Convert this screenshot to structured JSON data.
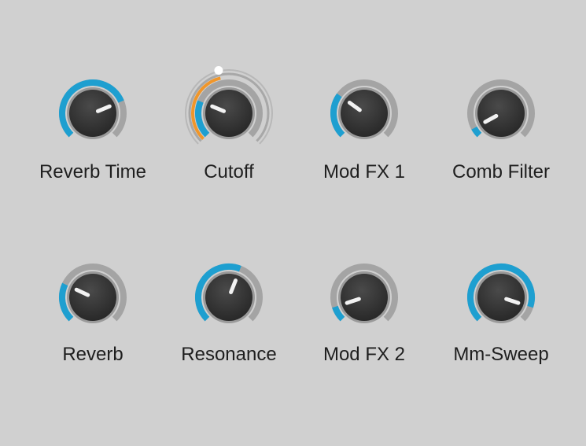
{
  "panel": {
    "accent_color": "#1e9fd0",
    "secondary_accent_color": "#f0962a",
    "knobs": [
      {
        "label": "Reverb Time",
        "value": 0.75,
        "icon": "rotary-knob-icon"
      },
      {
        "label": "Cutoff",
        "value": 0.25,
        "secondary_value": 0.45,
        "dual_ring": true,
        "icon": "rotary-knob-icon"
      },
      {
        "label": "Mod FX 1",
        "value": 0.3,
        "icon": "rotary-knob-icon"
      },
      {
        "label": "Comb Filter",
        "value": 0.06,
        "icon": "rotary-knob-icon"
      },
      {
        "label": "Reverb",
        "value": 0.26,
        "icon": "rotary-knob-icon"
      },
      {
        "label": "Resonance",
        "value": 0.58,
        "icon": "rotary-knob-icon"
      },
      {
        "label": "Mod FX 2",
        "value": 0.1,
        "icon": "rotary-knob-icon"
      },
      {
        "label": "Mm-Sweep",
        "value": 0.9,
        "icon": "rotary-knob-icon"
      }
    ]
  }
}
